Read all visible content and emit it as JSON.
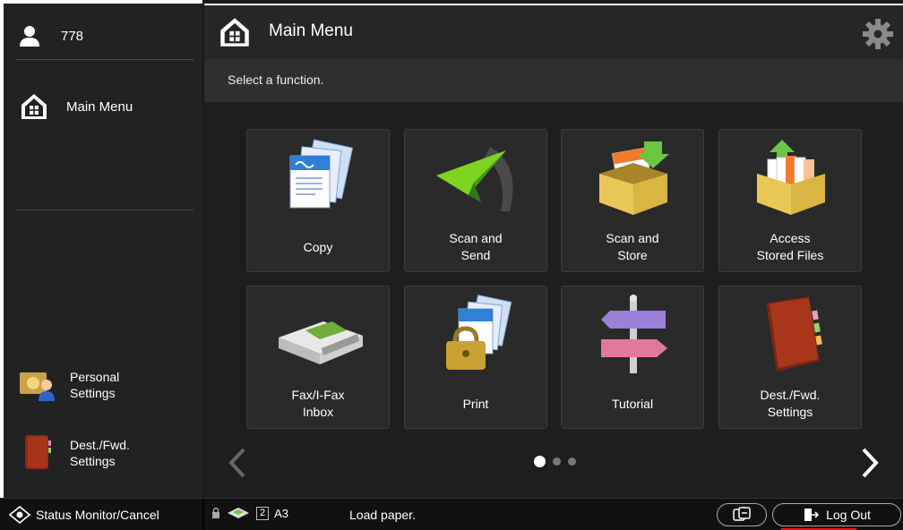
{
  "sidebar": {
    "user_id": "778",
    "main_menu_label": "Main Menu",
    "personal_settings_label": "Personal\nSettings",
    "dest_fwd_label": "Dest./Fwd.\nSettings"
  },
  "header": {
    "title": "Main Menu",
    "instruction": "Select a function."
  },
  "tiles": [
    {
      "label": "Copy",
      "icon": "copy-icon"
    },
    {
      "label": "Scan and\nSend",
      "icon": "scan-send-icon"
    },
    {
      "label": "Scan and\nStore",
      "icon": "scan-store-icon"
    },
    {
      "label": "Access\nStored Files",
      "icon": "stored-files-icon"
    },
    {
      "label": "Fax/I-Fax\nInbox",
      "icon": "fax-inbox-icon"
    },
    {
      "label": "Print",
      "icon": "print-icon"
    },
    {
      "label": "Tutorial",
      "icon": "tutorial-icon"
    },
    {
      "label": "Dest./Fwd.\nSettings",
      "icon": "dest-fwd-icon"
    }
  ],
  "pagination": {
    "pages": 3,
    "current": 1
  },
  "footer": {
    "status_monitor_label": "Status Monitor/Cancel",
    "tray_number": "2",
    "paper_size": "A3",
    "message": "Load paper.",
    "logout_label": "Log Out"
  },
  "colors": {
    "accent_red": "#e01b1b",
    "background": "#1e1e1e"
  }
}
